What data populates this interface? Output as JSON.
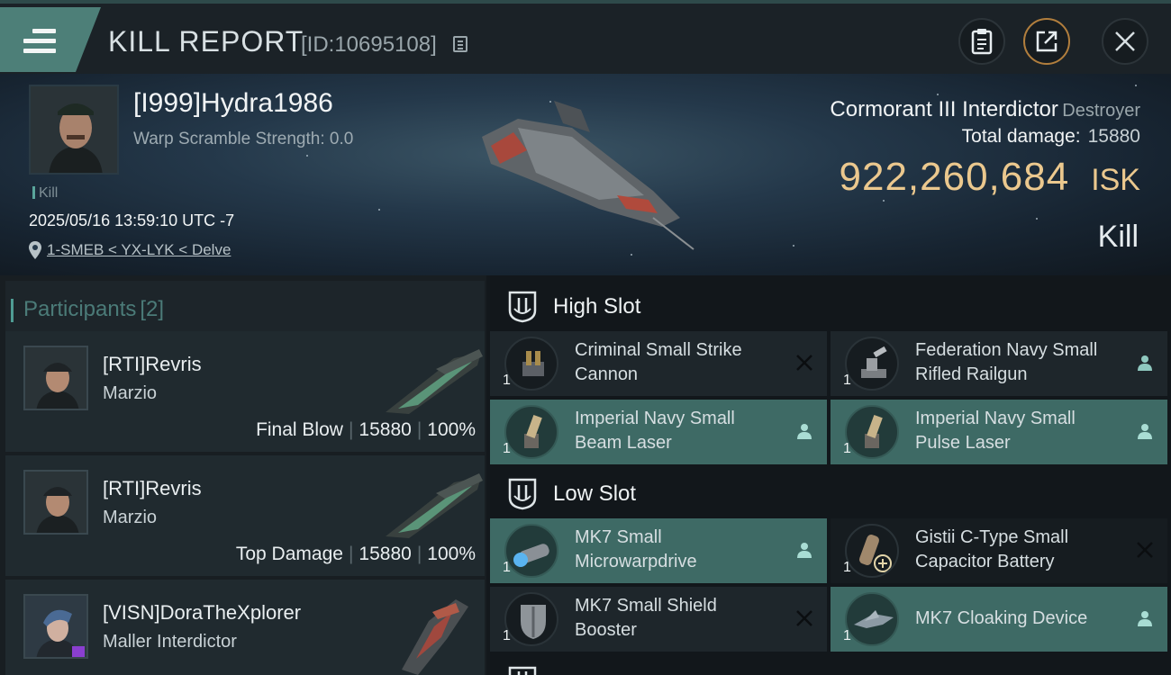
{
  "header": {
    "title": "KILL REPORT",
    "report_id": "[ID:10695108]"
  },
  "victim": {
    "name": "[I999]Hydra1986",
    "warp_scramble": "Warp Scramble Strength: 0.0",
    "kill_tag": "Kill",
    "datetime": "2025/05/16 13:59:10 UTC -7",
    "location": "1-SMEB < YX-LYK < Delve",
    "ship_name": "Cormorant III Interdictor",
    "ship_class": "Destroyer",
    "total_damage_label": "Total damage:",
    "total_damage_value": "15880",
    "isk_value": "922,260,684",
    "isk_unit": "ISK",
    "result": "Kill"
  },
  "participants": {
    "title": "Participants",
    "count": "[2]",
    "rows": [
      {
        "name": "[RTI]Revris",
        "ship": "Marzio",
        "role": "Final Blow",
        "damage": "15880",
        "percent": "100%"
      },
      {
        "name": "[RTI]Revris",
        "ship": "Marzio",
        "role": "Top Damage",
        "damage": "15880",
        "percent": "100%"
      },
      {
        "name": "[VISN]DoraTheXplorer",
        "ship": "Maller Interdictor"
      }
    ]
  },
  "fittings": {
    "high_slot": {
      "title": "High Slot",
      "modules": [
        {
          "name": "Criminal Small Strike Cannon",
          "qty": "1",
          "status": "destroyed",
          "owned": false
        },
        {
          "name": "Federation Navy Small Rifled Railgun",
          "qty": "1",
          "status": "dropped",
          "owned": false
        },
        {
          "name": "Imperial Navy Small Beam Laser",
          "qty": "1",
          "status": "dropped",
          "owned": true
        },
        {
          "name": "Imperial Navy Small Pulse Laser",
          "qty": "1",
          "status": "dropped",
          "owned": true
        }
      ]
    },
    "low_slot": {
      "title": "Low Slot",
      "modules": [
        {
          "name": "MK7 Small Microwarpdrive",
          "qty": "1",
          "status": "dropped",
          "owned": true
        },
        {
          "name": "Gistii C-Type Small Capacitor Battery",
          "qty": "1",
          "status": "destroyed",
          "owned": false
        },
        {
          "name": "MK7 Small Shield Booster",
          "qty": "1",
          "status": "destroyed",
          "owned": false
        },
        {
          "name": "MK7 Cloaking Device",
          "qty": "1",
          "status": "dropped",
          "owned": true
        }
      ]
    }
  },
  "colors": {
    "accent_teal": "#3e6a65",
    "isk_gold": "#ebc88e",
    "share_ring": "#b17e3d"
  }
}
